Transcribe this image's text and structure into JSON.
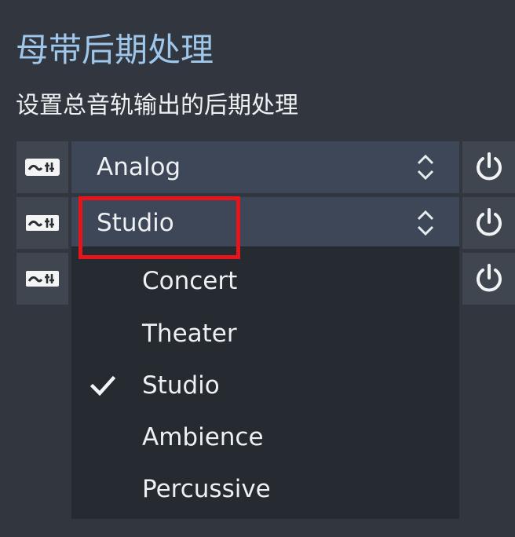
{
  "header": {
    "title": "母带后期处理",
    "subtitle": "设置总音轨输出的后期处理"
  },
  "rows": [
    {
      "icon": "equalizer-settings-icon",
      "value": "Analog",
      "power_icon": "power-icon"
    },
    {
      "icon": "equalizer-settings-icon",
      "value": "Studio",
      "power_icon": "power-icon"
    },
    {
      "icon": "equalizer-settings-icon",
      "value": "",
      "power_icon": "power-icon"
    }
  ],
  "dropdown": {
    "options": [
      {
        "label": "Concert",
        "selected": false
      },
      {
        "label": "Theater",
        "selected": false
      },
      {
        "label": "Studio",
        "selected": true
      },
      {
        "label": "Ambience",
        "selected": false
      },
      {
        "label": "Percussive",
        "selected": false
      }
    ],
    "selected_icon": "checkmark-icon"
  },
  "colors": {
    "background": "#32363e",
    "title": "#9ec7eb",
    "combo": "#3d4757",
    "button": "#3f4650",
    "dropdown": "#262a31",
    "highlight": "#e8141c"
  }
}
